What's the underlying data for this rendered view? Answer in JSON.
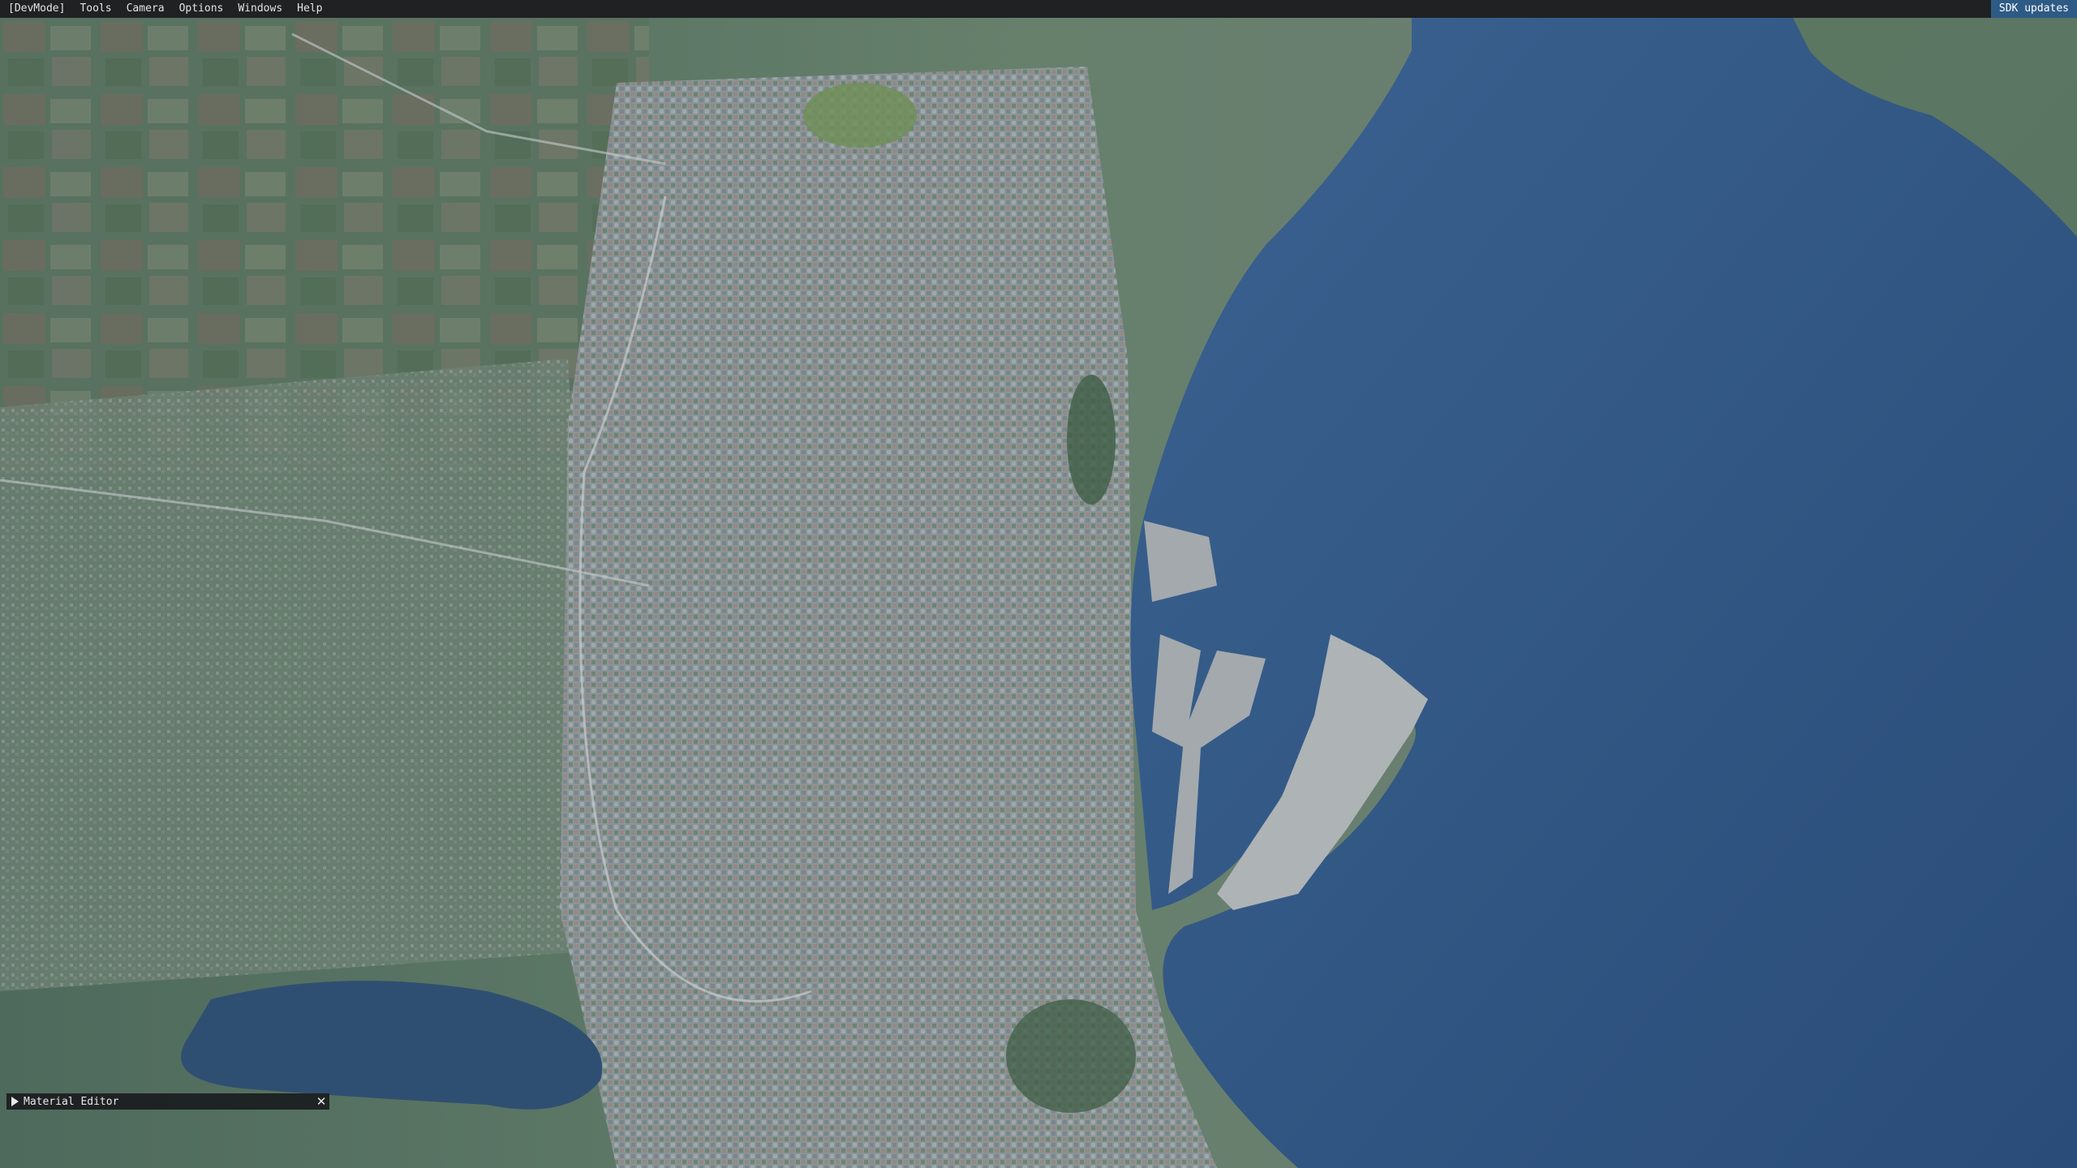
{
  "menubar": {
    "items": [
      "[DevMode]",
      "Tools",
      "Camera",
      "Options",
      "Windows",
      "Help"
    ],
    "right_label": "SDK updates"
  },
  "panel": {
    "title": "Material Editor"
  },
  "colors": {
    "menubar_bg": "#1f2123",
    "sdk_button_bg": "#2e5a86",
    "sea": "#2f527e",
    "land": "#5f7a66",
    "city": "#8a949a"
  },
  "icons": {
    "panel_expand": "triangle-right-icon",
    "panel_close": "close-icon"
  }
}
